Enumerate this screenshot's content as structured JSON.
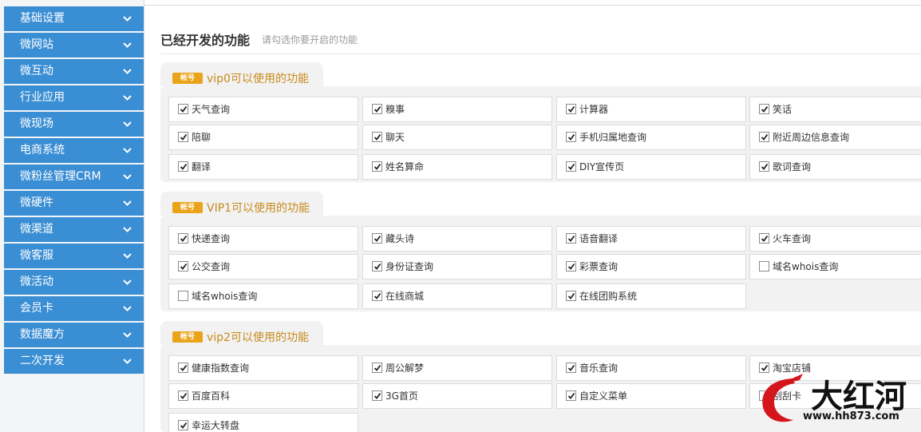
{
  "sidebar": {
    "items": [
      {
        "label": "基础设置"
      },
      {
        "label": "微网站"
      },
      {
        "label": "微互动"
      },
      {
        "label": "行业应用"
      },
      {
        "label": "微现场"
      },
      {
        "label": "电商系统"
      },
      {
        "label": "微粉丝管理CRM"
      },
      {
        "label": "微硬件"
      },
      {
        "label": "微渠道"
      },
      {
        "label": "微客服"
      },
      {
        "label": "微活动"
      },
      {
        "label": "会员卡"
      },
      {
        "label": "数据魔方"
      },
      {
        "label": "二次开发"
      }
    ],
    "chevron_icon": "chevron-down-icon"
  },
  "main": {
    "title": "已经开发的功能",
    "subtitle": "请勾选你要开启的功能",
    "badge_text": "帐号",
    "sections": [
      {
        "label": "vip0可以使用的功能",
        "options": [
          {
            "label": "天气查询",
            "checked": true
          },
          {
            "label": "糗事",
            "checked": true
          },
          {
            "label": "计算器",
            "checked": true
          },
          {
            "label": "笑话",
            "checked": true
          },
          {
            "label": "陪聊",
            "checked": true
          },
          {
            "label": "聊天",
            "checked": true
          },
          {
            "label": "手机归属地查询",
            "checked": true
          },
          {
            "label": "附近周边信息查询",
            "checked": true
          },
          {
            "label": "翻译",
            "checked": true
          },
          {
            "label": "姓名算命",
            "checked": true
          },
          {
            "label": "DIY宣传页",
            "checked": true
          },
          {
            "label": "歌词查询",
            "checked": true
          }
        ]
      },
      {
        "label": "VIP1可以使用的功能",
        "options": [
          {
            "label": "快递查询",
            "checked": true
          },
          {
            "label": "藏头诗",
            "checked": true
          },
          {
            "label": "语音翻译",
            "checked": true
          },
          {
            "label": "火车查询",
            "checked": true
          },
          {
            "label": "公交查询",
            "checked": true
          },
          {
            "label": "身份证查询",
            "checked": true
          },
          {
            "label": "彩票查询",
            "checked": true
          },
          {
            "label": "域名whois查询",
            "checked": false
          },
          {
            "label": "域名whois查询",
            "checked": false
          },
          {
            "label": "在线商城",
            "checked": true
          },
          {
            "label": "在线团购系统",
            "checked": true
          }
        ]
      },
      {
        "label": "vip2可以使用的功能",
        "options": [
          {
            "label": "健康指数查询",
            "checked": true
          },
          {
            "label": "周公解梦",
            "checked": true
          },
          {
            "label": "音乐查询",
            "checked": true
          },
          {
            "label": "淘宝店铺",
            "checked": true
          },
          {
            "label": "百度百科",
            "checked": true
          },
          {
            "label": "3G首页",
            "checked": true
          },
          {
            "label": "自定义菜单",
            "checked": true
          },
          {
            "label": "刮刮卡",
            "checked": false
          },
          {
            "label": "幸运大转盘",
            "checked": true
          }
        ]
      }
    ]
  },
  "watermark": {
    "logo_text": "大红河",
    "url": "www.hh873.com"
  },
  "colors": {
    "sidebar_item_bg": "#3a8ed4",
    "badge_bg": "#e9a41a",
    "section_label": "#c78a1a",
    "section_bg": "#f2f2f2"
  }
}
